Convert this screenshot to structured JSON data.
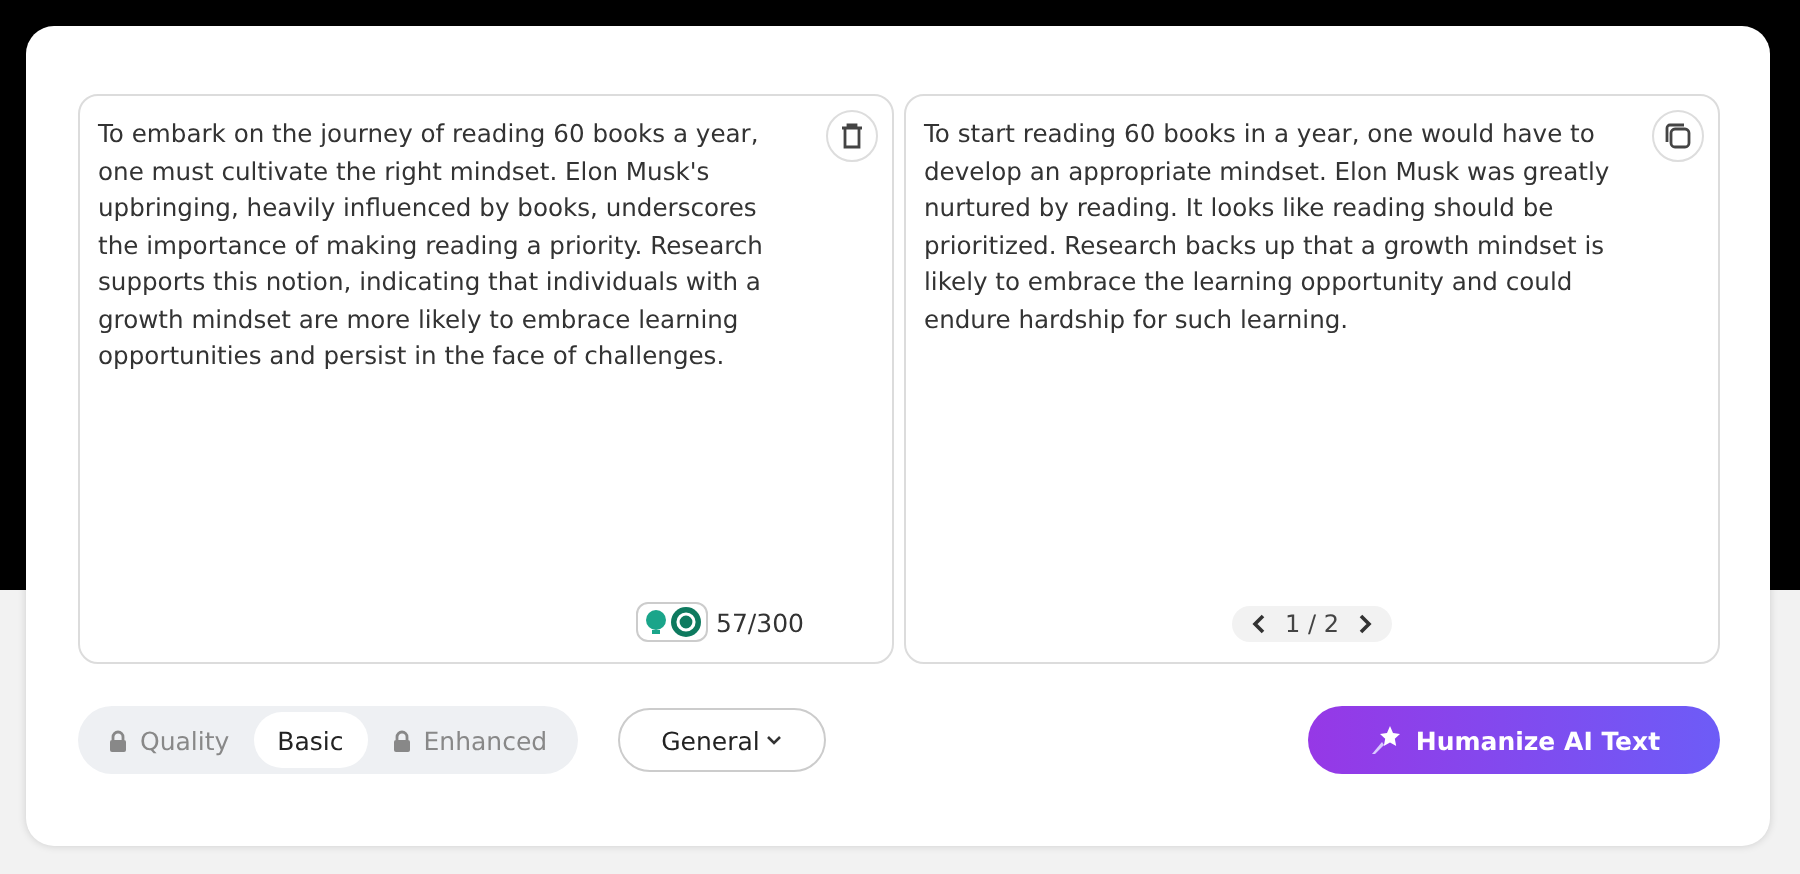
{
  "input_panel": {
    "text": "To embark on the journey of reading 60 books a year, one must cultivate the right mindset. Elon Musk's upbringing, heavily influenced by books, underscores the importance of making reading a priority. Research supports this notion, indicating that individuals with a growth mindset are more likely to embrace learning opportunities and persist in the face of challenges.",
    "word_count": "57/300"
  },
  "output_panel": {
    "text": "To start reading 60 books in a year, one would have to develop an appropriate mindset. Elon Musk was greatly nurtured by reading. It looks like reading should be prioritized. Research backs up that a growth mindset is likely to embrace the learning opportunity and could endure hardship for such learning.",
    "pager": "1 / 2"
  },
  "modes": [
    {
      "label": "Quality",
      "locked": true,
      "selected": false
    },
    {
      "label": "Basic",
      "locked": false,
      "selected": true
    },
    {
      "label": "Enhanced",
      "locked": true,
      "selected": false
    }
  ],
  "tone_dropdown": "General",
  "action_button": "Humanize AI Text"
}
